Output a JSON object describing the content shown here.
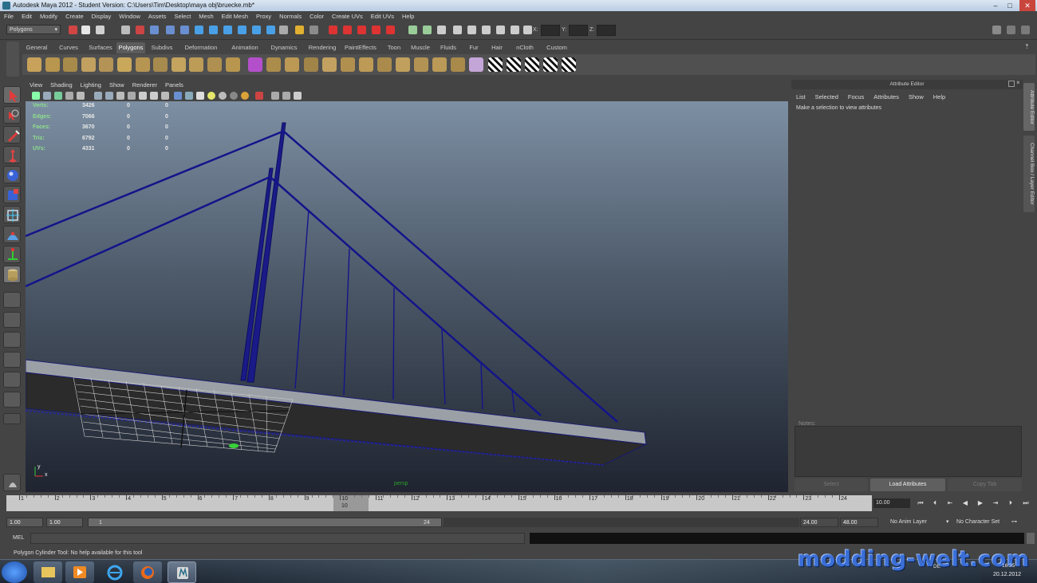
{
  "window": {
    "title": "Autodesk Maya 2012 - Student Version: C:\\Users\\Tim\\Desktop\\maya obj\\bruecke.mb*",
    "minimize": "–",
    "maximize": "□",
    "close": "✕"
  },
  "menubar": [
    "File",
    "Edit",
    "Modify",
    "Create",
    "Display",
    "Window",
    "Assets",
    "Select",
    "Mesh",
    "Edit Mesh",
    "Proxy",
    "Normals",
    "Color",
    "Create UVs",
    "Edit UVs",
    "Help"
  ],
  "statusline": {
    "mode": "Polygons",
    "x_label": "X:",
    "y_label": "Y:",
    "z_label": "Z:",
    "x_value": "",
    "y_value": "",
    "z_value": ""
  },
  "shelf": {
    "tabs": [
      "General",
      "Curves",
      "Surfaces",
      "Polygons",
      "Subdivs",
      "Deformation",
      "Animation",
      "Dynamics",
      "Rendering",
      "PaintEffects",
      "Toon",
      "Muscle",
      "Fluids",
      "Fur",
      "Hair",
      "nCloth",
      "Custom"
    ],
    "active_tab": "Polygons",
    "icons": [
      "poly-sphere-icon",
      "poly-cube-icon",
      "poly-cylinder-icon",
      "poly-cone-icon",
      "poly-plane-icon",
      "poly-torus-icon",
      "poly-prism-icon",
      "poly-pipe-icon",
      "poly-helix-icon",
      "poly-soccer-icon",
      "poly-platonic-icon",
      "combine-icon",
      "separate-icon",
      "extract-icon",
      "booleans-icon",
      "smooth-icon",
      "average-vertices-icon",
      "bridge-icon",
      "append-polygon-icon",
      "split-polygon-icon",
      "extrude-icon",
      "bevel-icon",
      "merge-icon",
      "wedge-icon",
      "sculpt-icon",
      "planar-mapping-icon",
      "cylindrical-mapping-icon",
      "spherical-mapping-icon",
      "automatic-mapping-icon",
      "uv-editor-icon"
    ]
  },
  "panel": {
    "menu": [
      "View",
      "Shading",
      "Lighting",
      "Show",
      "Renderer",
      "Panels"
    ]
  },
  "hud": {
    "rows": [
      {
        "label": "Verts:",
        "v1": "3426",
        "v2": "0",
        "v3": "0"
      },
      {
        "label": "Edges:",
        "v1": "7066",
        "v2": "0",
        "v3": "0"
      },
      {
        "label": "Faces:",
        "v1": "3670",
        "v2": "0",
        "v3": "0"
      },
      {
        "label": "Tris:",
        "v1": "6792",
        "v2": "0",
        "v3": "0"
      },
      {
        "label": "UVs:",
        "v1": "4331",
        "v2": "0",
        "v3": "0"
      }
    ],
    "camera": "persp",
    "axis_y": "y",
    "axis_x": "x"
  },
  "attribute_editor": {
    "title": "Attribute Editor",
    "menu": [
      "List",
      "Selected",
      "Focus",
      "Attributes",
      "Show",
      "Help"
    ],
    "message": "Make a selection to view attributes",
    "notes_label": "Notes:",
    "buttons": [
      "Select",
      "Load Attributes",
      "Copy Tab"
    ]
  },
  "side_tabs": [
    "Attribute Editor",
    "Channel Box / Layer Editor"
  ],
  "timeline": {
    "ticks": [
      "1",
      "2",
      "3",
      "4",
      "5",
      "6",
      "7",
      "8",
      "9",
      "10",
      "11",
      "12",
      "13",
      "14",
      "15",
      "16",
      "17",
      "18",
      "19",
      "20",
      "21",
      "22",
      "23",
      "24"
    ],
    "current_frame": "10",
    "current_time": "10.00"
  },
  "range": {
    "start": "1.00",
    "playback_start": "1.00",
    "slider_start": "1",
    "slider_end": "24",
    "playback_end": "24.00",
    "end": "48.00",
    "anim_layer": "No Anim Layer",
    "character_set": "No Character Set"
  },
  "mel": {
    "label": "MEL"
  },
  "helpline": {
    "text": "Polygon Cylinder Tool: No help available for this tool"
  },
  "taskbar": {
    "watermark": "modding-welt.com",
    "tray_lang": "DE",
    "time": "16:35",
    "date": "20.12.2012"
  }
}
